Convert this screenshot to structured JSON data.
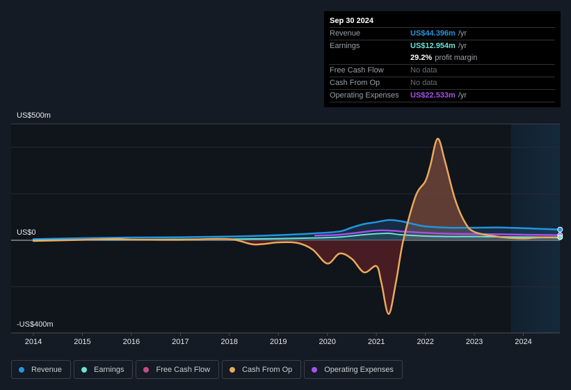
{
  "tooltip": {
    "date": "Sep 30 2024",
    "rows": [
      {
        "label": "Revenue",
        "value": "US$44.396m",
        "unit": "/yr",
        "color": "#2394df"
      },
      {
        "label": "Earnings",
        "value": "US$12.954m",
        "unit": "/yr",
        "color": "#6ce4d6"
      },
      {
        "label": "",
        "value": "29.2%",
        "unit": "profit margin",
        "color": "#ffffff"
      },
      {
        "label": "Free Cash Flow",
        "value": "No data",
        "unit": "",
        "color": ""
      },
      {
        "label": "Cash From Op",
        "value": "No data",
        "unit": "",
        "color": ""
      },
      {
        "label": "Operating Expenses",
        "value": "US$22.533m",
        "unit": "/yr",
        "color": "#a94fe8"
      }
    ]
  },
  "chart_data": {
    "type": "area",
    "title": "",
    "xlabel": "",
    "ylabel": "",
    "y_tick_labels": {
      "top": "US$500m",
      "zero": "US$0",
      "bottom": "-US$400m"
    },
    "ylim": [
      -400,
      500
    ],
    "xlim": [
      2013.6,
      2024.75
    ],
    "x_ticks": [
      "2014",
      "2015",
      "2016",
      "2017",
      "2018",
      "2019",
      "2020",
      "2021",
      "2022",
      "2023",
      "2024"
    ],
    "grid": true,
    "forecast_shade_start": 2023.75,
    "legend_position": "bottom-left",
    "series": [
      {
        "name": "Revenue",
        "color": "#2394df",
        "x": [
          2014.0,
          2015.0,
          2016.0,
          2017.0,
          2018.0,
          2019.0,
          2019.75,
          2020.25,
          2020.5,
          2020.75,
          2021.0,
          2021.25,
          2021.5,
          2021.75,
          2022.0,
          2022.5,
          2023.0,
          2023.5,
          2024.0,
          2024.5,
          2024.75
        ],
        "y": [
          5,
          9,
          12,
          13,
          16,
          22,
          30,
          38,
          55,
          70,
          78,
          87,
          82,
          70,
          60,
          54,
          54,
          55,
          52,
          48,
          46
        ]
      },
      {
        "name": "Earnings",
        "color": "#6ce4d6",
        "x": [
          2014.0,
          2015.0,
          2016.0,
          2017.0,
          2018.0,
          2019.0,
          2019.75,
          2020.25,
          2020.75,
          2021.0,
          2021.25,
          2021.5,
          2022.0,
          2022.5,
          2023.0,
          2023.5,
          2024.0,
          2024.75
        ],
        "y": [
          0,
          2,
          3,
          4,
          5,
          7,
          10,
          14,
          24,
          28,
          30,
          24,
          18,
          16,
          16,
          15,
          14,
          13
        ]
      },
      {
        "name": "Free Cash Flow",
        "color": "#c64a88",
        "x": [],
        "y": []
      },
      {
        "name": "Cash From Op",
        "color": "#e9aa5b",
        "x": [
          2014.0,
          2015.0,
          2015.7,
          2016.0,
          2017.0,
          2018.0,
          2018.5,
          2019.0,
          2019.4,
          2019.7,
          2020.0,
          2020.25,
          2020.5,
          2020.75,
          2021.0,
          2021.1,
          2021.25,
          2021.4,
          2021.55,
          2021.8,
          2022.0,
          2022.1,
          2022.25,
          2022.4,
          2022.6,
          2022.8,
          2023.0,
          2023.5,
          2024.0,
          2024.3,
          2024.75
        ],
        "y": [
          -3,
          2,
          6,
          3,
          2,
          5,
          -18,
          -9,
          -12,
          -40,
          -100,
          -57,
          -80,
          -138,
          -111,
          -180,
          -317,
          -180,
          0,
          189,
          254,
          320,
          437,
          340,
          180,
          80,
          36,
          15,
          8,
          12,
          12
        ]
      },
      {
        "name": "Operating Expenses",
        "color": "#a94fe8",
        "x": [
          2019.75,
          2020.25,
          2020.75,
          2021.0,
          2021.25,
          2021.5,
          2022.0,
          2022.5,
          2023.0,
          2023.5,
          2024.0,
          2024.75
        ],
        "y": [
          20,
          24,
          36,
          42,
          42,
          38,
          32,
          28,
          27,
          26,
          24,
          22
        ]
      }
    ]
  },
  "legend": [
    {
      "label": "Revenue",
      "color": "#2394df"
    },
    {
      "label": "Earnings",
      "color": "#6ce4d6"
    },
    {
      "label": "Free Cash Flow",
      "color": "#c64a88"
    },
    {
      "label": "Cash From Op",
      "color": "#e9aa5b"
    },
    {
      "label": "Operating Expenses",
      "color": "#a94fe8"
    }
  ]
}
